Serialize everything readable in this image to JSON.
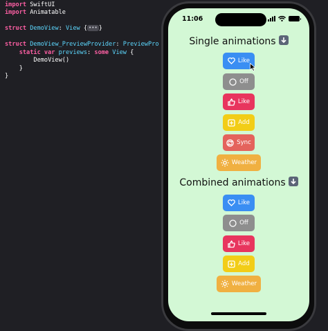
{
  "editor": {
    "lines": [
      {
        "t": [
          {
            "c": "kw",
            "v": "import"
          },
          {
            "c": "tx",
            "v": " SwiftUI"
          }
        ]
      },
      {
        "t": [
          {
            "c": "kw",
            "v": "import"
          },
          {
            "c": "tx",
            "v": " Animatable"
          }
        ]
      },
      {
        "t": []
      },
      {
        "t": [
          {
            "c": "kw",
            "v": "struct"
          },
          {
            "c": "ty",
            "v": " DemoView"
          },
          {
            "c": "tx",
            "v": ": "
          },
          {
            "c": "ty",
            "v": "View"
          },
          {
            "c": "tx",
            "v": " {"
          },
          {
            "c": "chip",
            "v": "•••"
          },
          {
            "c": "tx",
            "v": "}"
          }
        ]
      },
      {
        "t": []
      },
      {
        "t": [
          {
            "c": "kw",
            "v": "struct"
          },
          {
            "c": "ty",
            "v": " DemoView_PreviewProvider"
          },
          {
            "c": "tx",
            "v": ": "
          },
          {
            "c": "ty",
            "v": "PreviewPro"
          }
        ]
      },
      {
        "t": [
          {
            "c": "tx",
            "v": "    "
          },
          {
            "c": "kw",
            "v": "static var"
          },
          {
            "c": "ty",
            "v": " previews"
          },
          {
            "c": "tx",
            "v": ": "
          },
          {
            "c": "kw",
            "v": "some"
          },
          {
            "c": "ty",
            "v": " View"
          },
          {
            "c": "tx",
            "v": " {"
          }
        ]
      },
      {
        "t": [
          {
            "c": "tx",
            "v": "        DemoView()"
          }
        ]
      },
      {
        "t": [
          {
            "c": "tx",
            "v": "    }"
          }
        ]
      },
      {
        "t": [
          {
            "c": "tx",
            "v": "}"
          }
        ]
      }
    ]
  },
  "phone": {
    "time": "11:06",
    "single_title": "Single animations",
    "combined_title": "Combined animations",
    "single_buttons": [
      {
        "label": "Like",
        "icon": "heart-icon",
        "color": "#3a8ef3"
      },
      {
        "label": "Off",
        "icon": "circle-icon",
        "color": "#8e8e8e"
      },
      {
        "label": "Like",
        "icon": "thumbs-up-icon",
        "color": "#e8355e"
      },
      {
        "label": "Add",
        "icon": "plus-square-icon",
        "color": "#f2cd17"
      },
      {
        "label": "Sync",
        "icon": "sync-icon",
        "color": "#e4635c"
      },
      {
        "label": "Weather",
        "icon": "sun-icon",
        "color": "#f0b041"
      }
    ],
    "combined_buttons": [
      {
        "label": "Like",
        "icon": "heart-icon",
        "color": "#3a8ef3"
      },
      {
        "label": "Off",
        "icon": "circle-icon",
        "color": "#8e8e8e"
      },
      {
        "label": "Like",
        "icon": "thumbs-up-icon",
        "color": "#e8355e"
      },
      {
        "label": "Add",
        "icon": "plus-square-icon",
        "color": "#f2cd17"
      },
      {
        "label": "Weather",
        "icon": "sun-icon",
        "color": "#f0b041"
      }
    ]
  }
}
